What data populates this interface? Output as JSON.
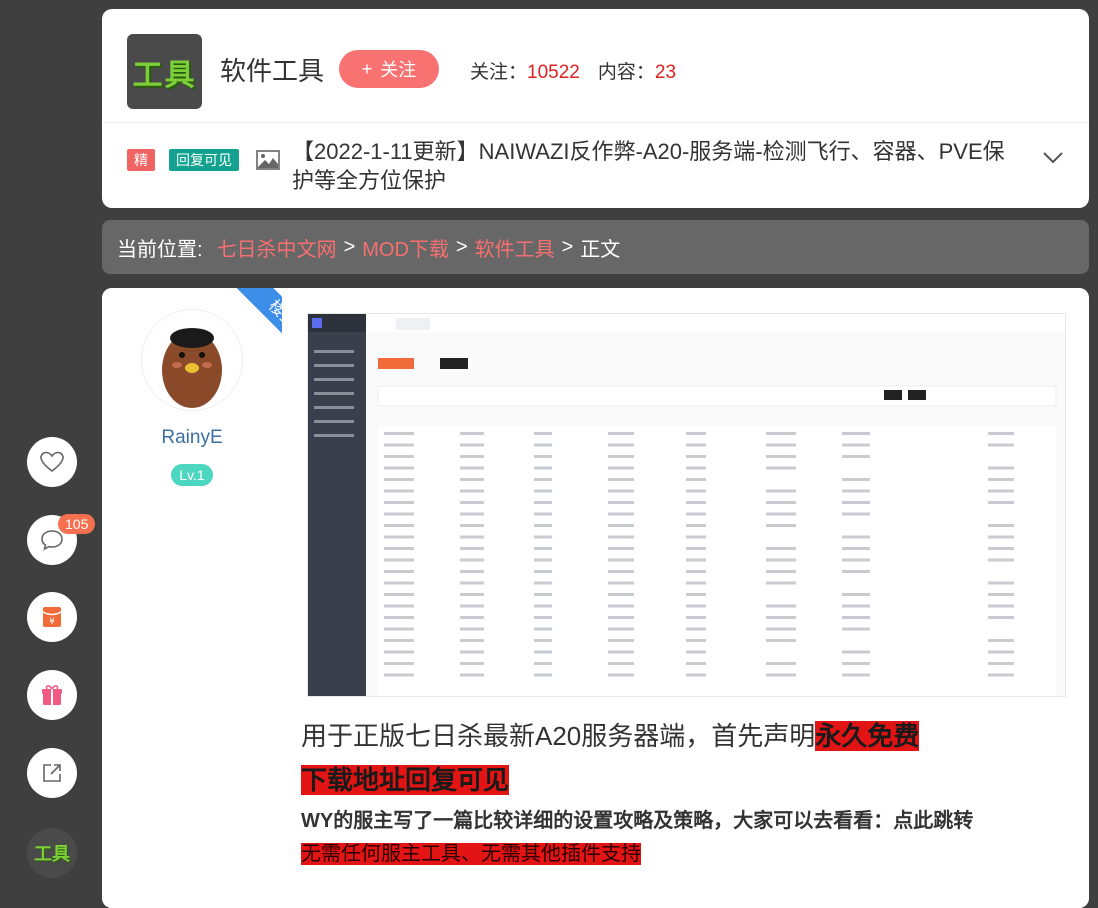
{
  "forum": {
    "logo_text": "工具",
    "name": "软件工具",
    "follow_label": "关注",
    "follow_plus": "+",
    "followers_label": "关注：",
    "followers_count": "10522",
    "content_label": "内容：",
    "content_count": "23"
  },
  "thread": {
    "badge_featured": "精",
    "badge_reply_visible": "回复可见",
    "title": "【2022-1-11更新】NAIWAZI反作弊-A20-服务端-检测飞行、容器、PVE保护等全方位保护"
  },
  "breadcrumb": {
    "label": "当前位置:",
    "items": [
      "七日杀中文网",
      "MOD下载",
      "软件工具"
    ],
    "current": "正文",
    "separator": ">"
  },
  "author": {
    "ribbon": "楼主",
    "name": "RainyE",
    "level": "Lv.1"
  },
  "post": {
    "p1_text": "用于正版七日杀最新A20服务器端，首先声明",
    "p1_highlight": "永久免费",
    "p2_highlight": "下载地址回复可见",
    "p3_text": "WY的服主写了一篇比较详细的设置攻略及策略，大家可以去看看：点此跳转",
    "p4_highlight": "无需任何服主工具、无需其他插件支持"
  },
  "sidebar": {
    "comment_count": "105",
    "logo_text": "工具"
  },
  "colors": {
    "accent_red": "#f87272",
    "link_red": "#f76f6f",
    "teal": "#13a28f",
    "highlight": "#e31414"
  }
}
